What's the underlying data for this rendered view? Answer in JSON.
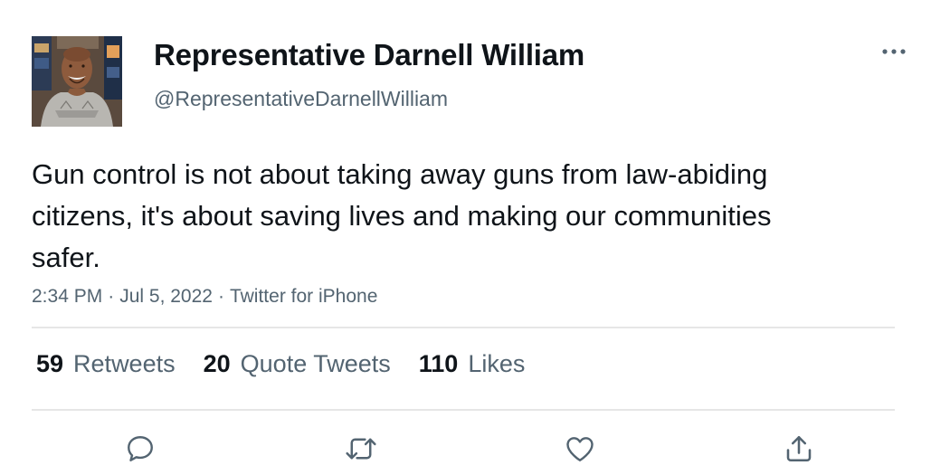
{
  "tweet": {
    "author": {
      "display_name": "Representative Darnell William",
      "handle": "@RepresentativeDarnellWilliam"
    },
    "text": "Gun control is not about taking away guns from law-abiding citizens, it's about saving lives and making our communities safer.",
    "meta": {
      "time": "2:34 PM",
      "separator": "·",
      "date": "Jul 5, 2022",
      "source": "Twitter for iPhone"
    },
    "stats": {
      "retweets": {
        "count": "59",
        "label": "Retweets"
      },
      "quote_tweets": {
        "count": "20",
        "label": "Quote Tweets"
      },
      "likes": {
        "count": "110",
        "label": "Likes"
      }
    },
    "actions": [
      "reply-icon",
      "retweet-icon",
      "like-icon",
      "share-icon"
    ]
  },
  "colors": {
    "text_primary": "#0f1419",
    "text_secondary": "#536471",
    "divider": "#e6e6e6",
    "icon": "#536471"
  }
}
